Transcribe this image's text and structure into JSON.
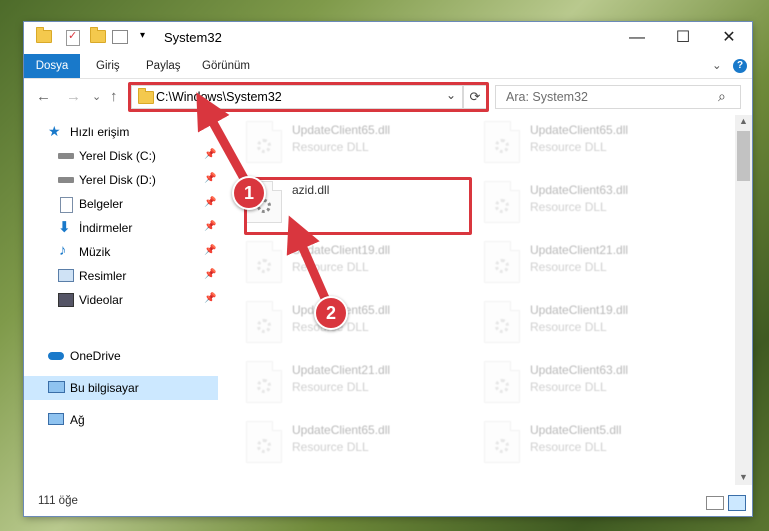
{
  "window": {
    "title": "System32",
    "minimize_glyph": "—",
    "maximize_glyph": "☐",
    "close_glyph": "✕"
  },
  "ribbon": {
    "tabs": [
      "Dosya",
      "Giriş",
      "Paylaş",
      "Görünüm"
    ],
    "collapse_glyph": "⌄",
    "help_glyph": "?"
  },
  "nav": {
    "back_glyph": "←",
    "forward_glyph": "→",
    "recent_glyph": "⌄",
    "up_glyph": "↑",
    "address": "C:\\Windows\\System32",
    "dropdown_glyph": "⌄",
    "refresh_glyph": "⟳",
    "search_placeholder": "Ara: System32",
    "search_glyph": "⌕"
  },
  "sidebar": {
    "quick_access": "Hızlı erişim",
    "items": [
      {
        "label": "Yerel Disk (C:)",
        "icon": "drive-icon"
      },
      {
        "label": "Yerel Disk (D:)",
        "icon": "drive-icon"
      },
      {
        "label": "Belgeler",
        "icon": "documents-icon"
      },
      {
        "label": "İndirmeler",
        "icon": "downloads-icon"
      },
      {
        "label": "Müzik",
        "icon": "music-icon"
      },
      {
        "label": "Resimler",
        "icon": "pictures-icon"
      },
      {
        "label": "Videolar",
        "icon": "videos-icon"
      }
    ],
    "pin_glyph": "📌",
    "onedrive": "OneDrive",
    "this_pc": "Bu bilgisayar",
    "network": "Ağ"
  },
  "files": {
    "highlighted": {
      "name": "azid.dll",
      "type": ""
    },
    "left_column": [
      {
        "name": "UpdateClient65.dll",
        "type": "Resource DLL"
      },
      {
        "name": "UpdateClient19.dll",
        "type": "Resource DLL"
      },
      {
        "name": "UpdateClient65.dll",
        "type": "Resource DLL"
      },
      {
        "name": "UpdateClient21.dll",
        "type": "Resource DLL"
      },
      {
        "name": "UpdateClient65.dll",
        "type": "Resource DLL"
      }
    ],
    "right_column": [
      {
        "name": "UpdateClient65.dll",
        "type": "Resource DLL"
      },
      {
        "name": "UpdateClient63.dll",
        "type": "Resource DLL"
      },
      {
        "name": "UpdateClient21.dll",
        "type": "Resource DLL"
      },
      {
        "name": "UpdateClient19.dll",
        "type": "Resource DLL"
      },
      {
        "name": "UpdateClient63.dll",
        "type": "Resource DLL"
      },
      {
        "name": "UpdateClient5.dll",
        "type": "Resource DLL"
      }
    ]
  },
  "status": {
    "item_count": "111 öğe"
  },
  "annotations": {
    "step1": "1",
    "step2": "2",
    "color": "#d9363e"
  }
}
